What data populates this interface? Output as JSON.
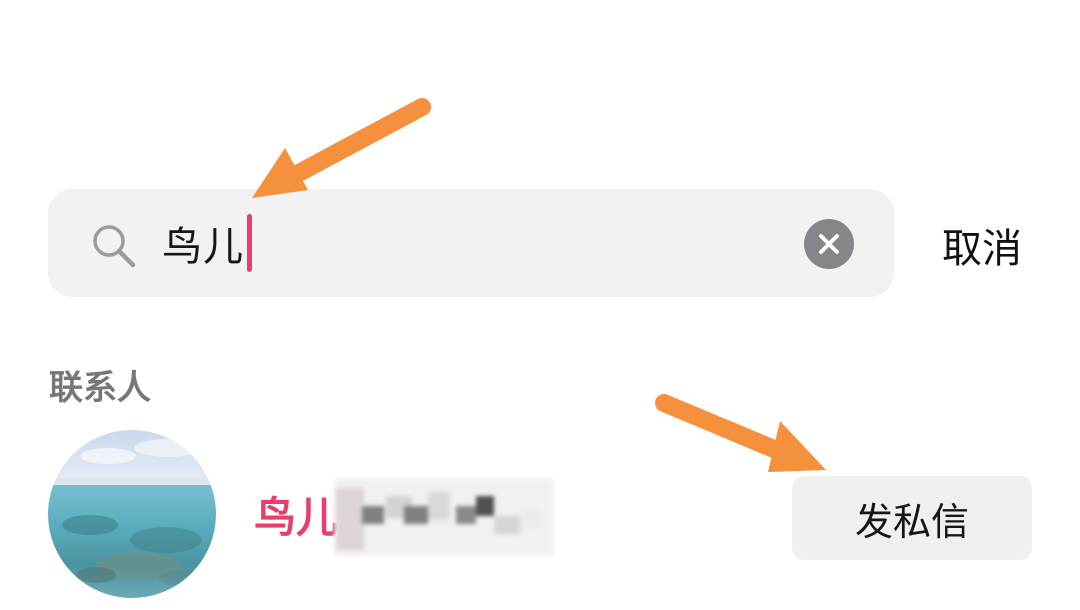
{
  "search": {
    "query": "鸟儿",
    "search_icon": "search-icon",
    "clear_icon": "clear-icon"
  },
  "cancel_label": "取消",
  "sections": [
    {
      "title": "联系人",
      "contacts": [
        {
          "name_visible": "鸟儿",
          "action_label": "发私信"
        }
      ]
    }
  ],
  "colors": {
    "accent": "#e73f6c",
    "annotation": "#f5903d"
  }
}
